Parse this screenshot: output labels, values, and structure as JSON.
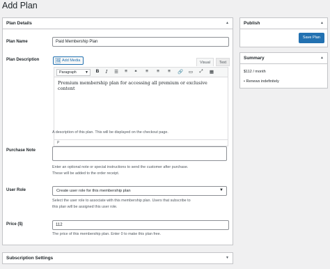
{
  "page": {
    "title": "Add Plan"
  },
  "details": {
    "heading": "Plan Details",
    "plan_name": {
      "label": "Plan Name",
      "value": "Paid Membership Plan"
    },
    "plan_description": {
      "label": "Plan Description",
      "add_media": "Add Media",
      "tab_visual": "Visual",
      "tab_text": "Text",
      "format": "Paragraph",
      "content": "Premium membership plan for accessing all premium or exclusive content",
      "path": "P",
      "help": "A description of this plan. This will be displayed on the checkout page."
    },
    "purchase_note": {
      "label": "Purchase Note",
      "value": "",
      "help_line1": "Enter an optional note or special instructions to send the customer after purchase.",
      "help_line2": "These will be added to the order receipt."
    },
    "user_role": {
      "label": "User Role",
      "selected": "Create user role for this membership plan",
      "help_line1": "Select the user role to associate with this membership plan. Users that subscribe to",
      "help_line2": "this plan will be assigned this user role."
    },
    "price": {
      "label": "Price ($)",
      "value": "112",
      "help": "The price of this membership plan. Enter 0 to make this plan free."
    }
  },
  "subscription": {
    "heading": "Subscription Settings"
  },
  "publish": {
    "heading": "Publish",
    "save_label": "Save Plan"
  },
  "summary": {
    "heading": "Summary",
    "price": "$112 / month",
    "bullet": "Renews indefinitely"
  },
  "icons": {
    "collapse": "▲",
    "expand": "▼",
    "media": "🖼",
    "bold": "B",
    "italic": "I",
    "bullist": "☰",
    "numlist": "≡",
    "quote": "❝",
    "alignleft": "≡",
    "aligncenter": "≡",
    "alignright": "≡",
    "link": "🔗",
    "more": "▭",
    "fullscreen": "⤢",
    "kitchensink": "▦"
  }
}
